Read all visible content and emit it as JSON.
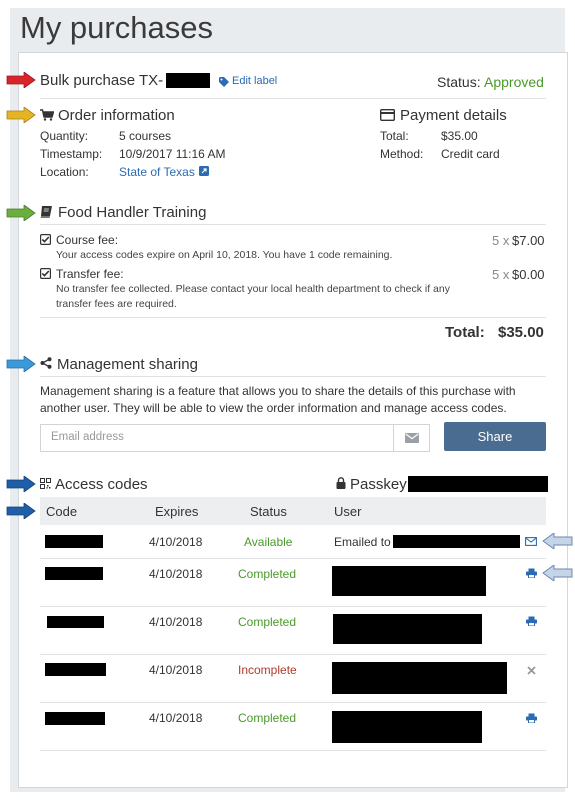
{
  "page": {
    "title": "My purchases"
  },
  "purchase": {
    "name": "Bulk purchase TX-",
    "edit_label": "Edit label",
    "status_label": "Status:",
    "status_value": "Approved"
  },
  "order": {
    "heading": "Order information",
    "quantity_label": "Quantity:",
    "quantity_value": "5 courses",
    "timestamp_label": "Timestamp:",
    "timestamp_value": "10/9/2017 11:16 AM",
    "location_label": "Location:",
    "location_value": "State of Texas"
  },
  "payment": {
    "heading": "Payment details",
    "total_label": "Total:",
    "total_value": "$35.00",
    "method_label": "Method:",
    "method_value": "Credit card"
  },
  "course": {
    "heading": "Food Handler Training",
    "course_fee_label": "Course fee:",
    "course_fee_desc": "Your access codes expire on April 10, 2018. You have 1 code remaining.",
    "course_fee_qty": "5 x",
    "course_fee_price": "$7.00",
    "transfer_fee_label": "Transfer fee:",
    "transfer_fee_desc_1": "No transfer fee collected. Please contact your local health department to check if any",
    "transfer_fee_desc_2": "transfer fees are required.",
    "transfer_fee_qty": "5 x",
    "transfer_fee_price": "$0.00",
    "total_label": "Total:",
    "total_value": "$35.00"
  },
  "sharing": {
    "heading": "Management sharing",
    "desc_1": "Management sharing is a feature that allows you to share the details of this purchase with",
    "desc_2": "another user. They will be able to view the order information and manage access codes.",
    "email_placeholder": "Email address",
    "share_label": "Share"
  },
  "access_codes": {
    "heading": "Access codes",
    "passkey_label": "Passkey:",
    "columns": [
      "Code",
      "Expires",
      "Status",
      "User"
    ],
    "rows": [
      {
        "expires": "4/10/2018",
        "status": "Available",
        "user_prefix": "Emailed to",
        "action": "mail-icon"
      },
      {
        "expires": "4/10/2018",
        "status": "Completed",
        "user_prefix": "",
        "action": "print-icon"
      },
      {
        "expires": "4/10/2018",
        "status": "Completed",
        "user_prefix": "",
        "action": "print-icon"
      },
      {
        "expires": "4/10/2018",
        "status": "Incomplete",
        "user_prefix": "",
        "action": "close-icon"
      },
      {
        "expires": "4/10/2018",
        "status": "Completed",
        "user_prefix": "",
        "action": "print-icon"
      }
    ]
  },
  "colors": {
    "approved": "#4a9a2a",
    "completed": "#4a9a2a",
    "incomplete": "#b23a2a",
    "link": "#2a6bb3",
    "share_button": "#496c90",
    "arrow_red": "#d8232a",
    "arrow_yellow": "#e6b422",
    "arrow_green": "#6aae3f",
    "arrow_light_blue": "#3a9ad9",
    "arrow_dark_blue": "#1f5fa8",
    "arrow_pale_blue": "#c6d4ea"
  }
}
